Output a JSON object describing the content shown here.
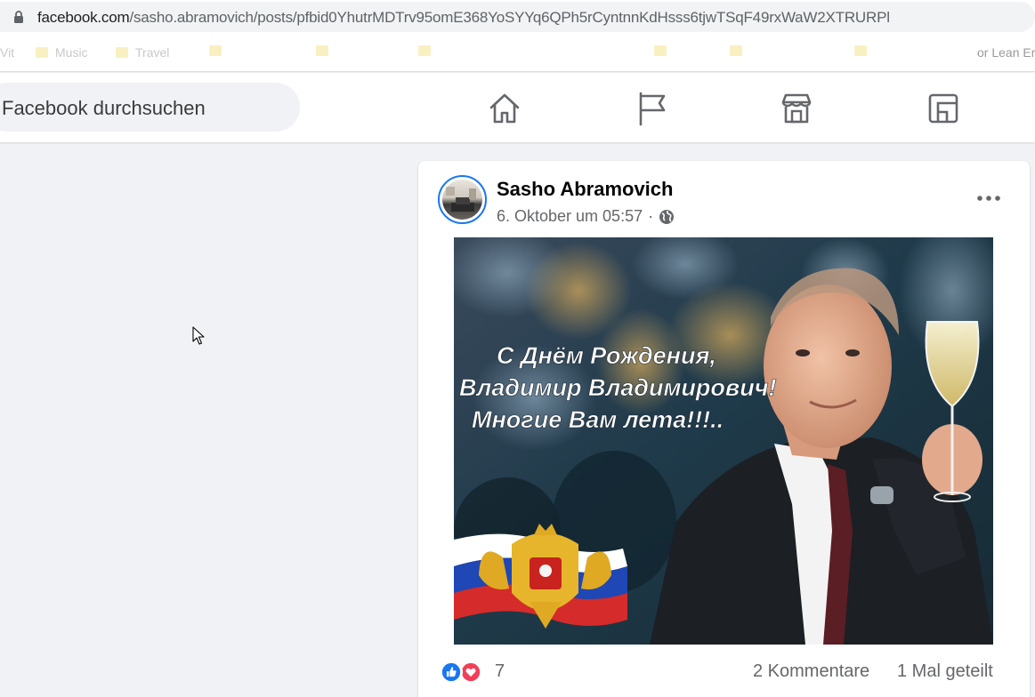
{
  "browser": {
    "url_host": "facebook.com",
    "url_path": "/sasho.abramovich/posts/pfbid0YhutrMDTrv95omE368YoSYYq6QPh5rCyntnnKdHsss6tjwTSqF49rxWaW2XTRURPl",
    "bookmarks": [
      "Vit",
      "Music",
      "Travel",
      "",
      "",
      "",
      "",
      "",
      "",
      "or Lean Er"
    ]
  },
  "header": {
    "search_placeholder": "Facebook durchsuchen",
    "nav": [
      {
        "icon": "home-icon"
      },
      {
        "icon": "pages-flag-icon"
      },
      {
        "icon": "marketplace-icon"
      },
      {
        "icon": "gaming-icon"
      }
    ]
  },
  "post": {
    "author": "Sasho Abramovich",
    "timestamp": "6. Oktober um 05:57",
    "separator": "·",
    "audience_icon": "globe-icon",
    "image_caption": {
      "line1": "С Днём Рождения,",
      "line2": "Владимир Владимирович!",
      "line3": "Многие Вам лета!!!.."
    },
    "reaction_count": "7",
    "comments": "2 Kommentare",
    "shares": "1 Mal geteilt"
  },
  "colors": {
    "accent": "#1877f2",
    "love": "#f33e58",
    "text_secondary": "#65676b",
    "page_bg": "#f0f2f5"
  }
}
